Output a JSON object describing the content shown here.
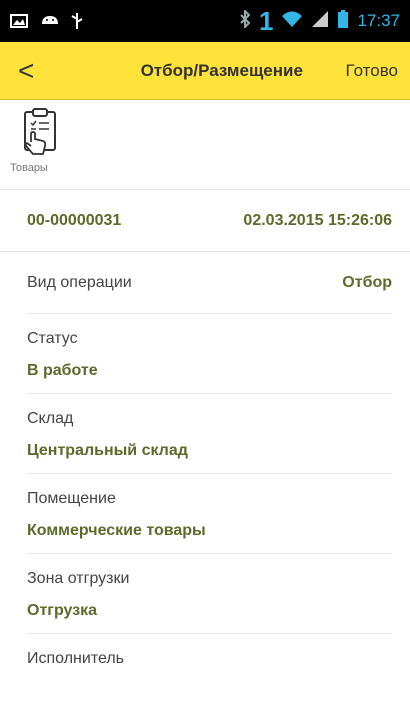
{
  "status_bar": {
    "time": "17:37",
    "notification_count": "1",
    "icons": [
      "image-icon",
      "android-icon",
      "usb-icon",
      "bluetooth-icon",
      "wifi-icon",
      "signal-icon",
      "battery-icon"
    ]
  },
  "app_bar": {
    "back_label": "<",
    "title": "Отбор/Размещение",
    "done_label": "Готово",
    "color": "#ffe23a"
  },
  "toolbar": {
    "items": [
      {
        "label": "Товары",
        "icon": "clipboard-tap-icon"
      }
    ]
  },
  "document": {
    "number": "00-00000031",
    "datetime": "02.03.2015 15:26:06"
  },
  "fields": {
    "operation": {
      "label": "Вид операции",
      "value": "Отбор"
    },
    "status": {
      "label": "Статус",
      "value": "В работе"
    },
    "warehouse": {
      "label": "Склад",
      "value": "Центральный склад"
    },
    "room": {
      "label": "Помещение",
      "value": "Коммерческие товары"
    },
    "shipping_zone": {
      "label": "Зона отгрузки",
      "value": "Отгрузка"
    },
    "executor": {
      "label": "Исполнитель"
    }
  },
  "colors": {
    "value_text": "#5b6b2a",
    "accent": "#ffe23a",
    "status_icons": "#31b6e7"
  }
}
